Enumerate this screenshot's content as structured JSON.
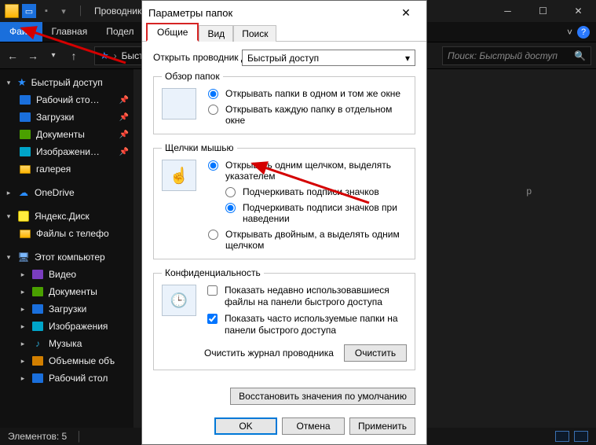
{
  "explorer": {
    "title": "Проводник",
    "ribbon": {
      "file": "Файл",
      "home": "Главная",
      "share": "Подел"
    },
    "addressbar": {
      "crumb": "Быстр"
    },
    "search": {
      "placeholder": "Поиск: Быстрый доступ"
    },
    "sidebar": {
      "quick": "Быстрый доступ",
      "desktop": "Рабочий сто…",
      "downloads": "Загрузки",
      "documents": "Документы",
      "pictures": "Изображени…",
      "gallery": "галерея",
      "onedrive": "OneDrive",
      "yadisk": "Яндекс.Диск",
      "yadisk_files": "Файлы с телефо",
      "thispc": "Этот компьютер",
      "videos": "Видео",
      "documents2": "Документы",
      "downloads2": "Загрузки",
      "pictures2": "Изображения",
      "music": "Музыка",
      "volumes": "Объемные объ",
      "desktop2": "Рабочий стол"
    },
    "content": {
      "stray_label": "р"
    },
    "status": {
      "items": "Элементов: 5"
    }
  },
  "dialog": {
    "title": "Параметры папок",
    "tabs": {
      "general": "Общие",
      "view": "Вид",
      "search": "Поиск"
    },
    "open_in_label": "Открыть проводник для:",
    "open_in_value": "Быстрый доступ",
    "browse": {
      "legend": "Обзор папок",
      "same": "Открывать папки в одном и том же окне",
      "new": "Открывать каждую папку в отдельном окне"
    },
    "click": {
      "legend": "Щелчки мышью",
      "single": "Открывать одним щелчком, выделять указателем",
      "underline_always": "Подчеркивать подписи значков",
      "underline_hover": "Подчеркивать подписи значков при наведении",
      "double": "Открывать двойным, а выделять одним щелчком"
    },
    "privacy": {
      "legend": "Конфиденциальность",
      "recent_files": "Показать недавно использовавшиеся файлы на панели быстрого доступа",
      "frequent_folders": "Показать часто используемые папки на панели быстрого доступа",
      "clear_label": "Очистить журнал проводника",
      "clear_btn": "Очистить"
    },
    "restore": "Восстановить значения по умолчанию",
    "ok": "OK",
    "cancel": "Отмена",
    "apply": "Применить"
  }
}
